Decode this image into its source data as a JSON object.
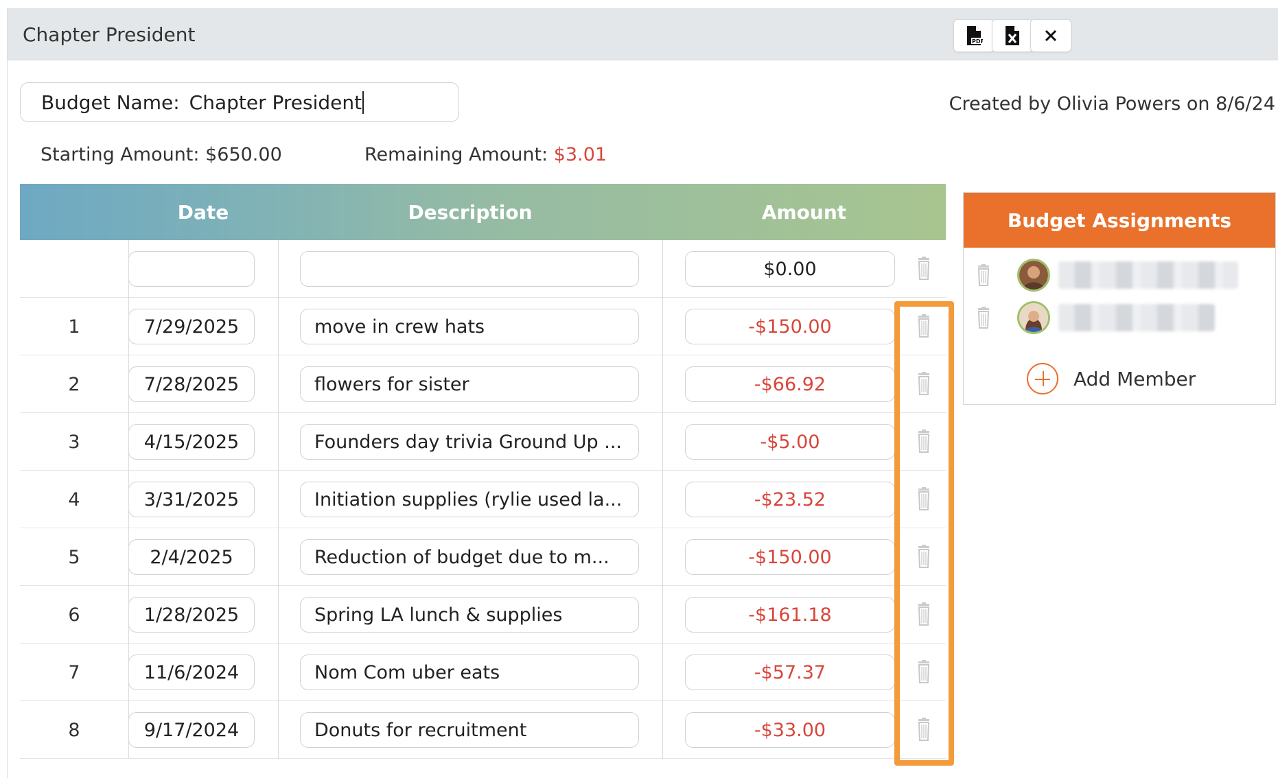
{
  "window": {
    "title": "Chapter President",
    "buttons": [
      {
        "name": "export-pdf",
        "icon": "file-pdf-icon"
      },
      {
        "name": "export-excel",
        "icon": "file-excel-icon"
      },
      {
        "name": "close",
        "icon": "close-icon"
      }
    ]
  },
  "budget": {
    "name_label": "Budget Name:",
    "name_value": "Chapter President",
    "created": "Created by Olivia Powers on 8/6/24",
    "starting_label": "Starting Amount:",
    "starting_value": "$650.00",
    "remaining_label": "Remaining Amount:",
    "remaining_value": "$3.01"
  },
  "table": {
    "headers": {
      "number": "",
      "date": "Date",
      "description": "Description",
      "amount": "Amount"
    },
    "new_row": {
      "date": "",
      "description": "",
      "amount": "$0.00"
    },
    "rows": [
      {
        "num": "1",
        "date": "7/29/2025",
        "description": "move in crew hats",
        "amount": "-$150.00"
      },
      {
        "num": "2",
        "date": "7/28/2025",
        "description": "flowers for sister",
        "amount": "-$66.92"
      },
      {
        "num": "3",
        "date": "4/15/2025",
        "description": "Founders day trivia Ground Up ...",
        "amount": "-$5.00"
      },
      {
        "num": "4",
        "date": "3/31/2025",
        "description": "Initiation supplies (rylie used la...",
        "amount": "-$23.52"
      },
      {
        "num": "5",
        "date": "2/4/2025",
        "description": "Reduction of budget due to m...",
        "amount": "-$150.00"
      },
      {
        "num": "6",
        "date": "1/28/2025",
        "description": "Spring LA lunch & supplies",
        "amount": "-$161.18"
      },
      {
        "num": "7",
        "date": "11/6/2024",
        "description": "Nom Com uber eats",
        "amount": "-$57.37"
      },
      {
        "num": "8",
        "date": "9/17/2024",
        "description": "Donuts for recruitment",
        "amount": "-$33.00"
      }
    ]
  },
  "assignments": {
    "title": "Budget Assignments",
    "add_label": "Add Member"
  },
  "colors": {
    "accent_orange": "#e9712c",
    "negative_red": "#d9453a",
    "highlight_orange": "#f39a3b",
    "header_gradient_start": "#6ea8c3",
    "header_gradient_end": "#a8c590"
  }
}
